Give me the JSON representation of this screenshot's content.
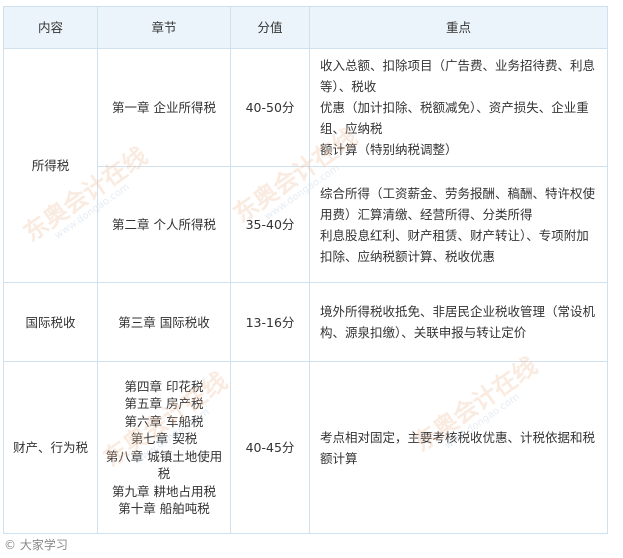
{
  "header": {
    "col_content": "内容",
    "col_chapter": "章节",
    "col_score": "分值",
    "col_points": "重点"
  },
  "rows": {
    "income_tax": {
      "label": "所得税",
      "ch1": {
        "chapter": "第一章 企业所得税",
        "score": "40-50分",
        "points": [
          "收入总额、扣除项目（广告费、业务招待费、利息等）、税收",
          "优惠（加计扣除、税额减免）、资产损失、企业重组、应纳税",
          "额计算（特别纳税调整）"
        ]
      },
      "ch2": {
        "chapter": "第二章 个人所得税",
        "score": "35-40分",
        "points": [
          "综合所得（工资薪金、劳务报酬、稿酬、特许权使用费）汇算清缴、经营所得、分类所得",
          "利息股息红利、财产租赁、财产转让）、专项附加扣除、应纳税额计算、税收优惠"
        ]
      }
    },
    "intl_tax": {
      "label": "国际税收",
      "chapter": "第三章 国际税收",
      "score": "13-16分",
      "points": "境外所得税收抵免、非居民企业税收管理（常设机构、源泉扣缴）、关联申报与转让定价"
    },
    "property_tax": {
      "label": "财产、行为税",
      "score": "40-45分",
      "chapters": [
        "第四章 印花税",
        "第五章 房产税",
        "第六章 车船税",
        "第七章 契税",
        "第八章 城镇土地使用税",
        "第九章 耕地占用税",
        "第十章 船舶吨税"
      ],
      "points": "考点相对固定，主要考核税收优惠、计税依据和税额计算"
    }
  },
  "watermark": {
    "brand": "东奥会计在线",
    "url": "www.dongao.com"
  },
  "footer_mark": "© 大家学习"
}
